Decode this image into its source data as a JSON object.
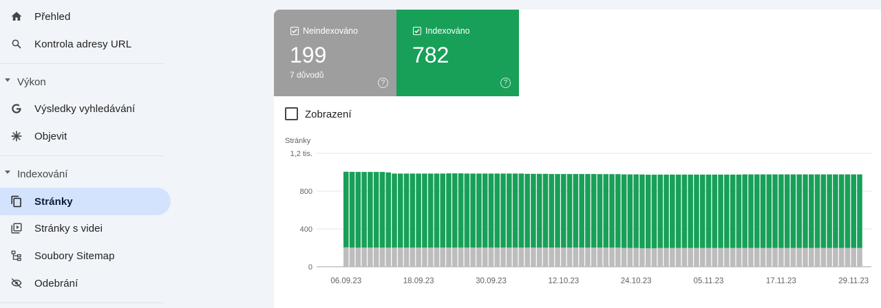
{
  "sidebar": {
    "overview": {
      "label": "Přehled",
      "icon": "home-icon"
    },
    "url_inspection": {
      "label": "Kontrola adresy URL",
      "icon": "search-icon"
    },
    "performance": {
      "section_label": "Výkon",
      "items": [
        {
          "label": "Výsledky vyhledávání",
          "icon": "google-g-icon"
        },
        {
          "label": "Objevit",
          "icon": "asterisk-icon"
        }
      ]
    },
    "indexing": {
      "section_label": "Indexování",
      "items": [
        {
          "label": "Stránky",
          "icon": "pages-icon",
          "active": true
        },
        {
          "label": "Stránky s videi",
          "icon": "video-pages-icon"
        },
        {
          "label": "Soubory Sitemap",
          "icon": "sitemap-icon"
        },
        {
          "label": "Odebrání",
          "icon": "eye-off-icon"
        }
      ]
    }
  },
  "cards": {
    "not_indexed": {
      "label": "Neindexováno",
      "value": "199",
      "sub": "7 důvodů",
      "color": "#9e9e9e",
      "checked": true
    },
    "indexed": {
      "label": "Indexováno",
      "value": "782",
      "color": "#18a058",
      "checked": true
    }
  },
  "overlay": {
    "label": "Zobrazení",
    "checked": false
  },
  "chart_data": {
    "type": "bar",
    "stacked": true,
    "ylabel": "Stránky",
    "ylim": [
      0,
      1200
    ],
    "y_ticks": [
      {
        "value": 0,
        "label": "0"
      },
      {
        "value": 400,
        "label": "400"
      },
      {
        "value": 800,
        "label": "800"
      },
      {
        "value": 1200,
        "label": "1,2 tis."
      }
    ],
    "x_tick_labels": [
      "06.09.23",
      "18.09.23",
      "30.09.23",
      "12.10.23",
      "24.10.23",
      "05.11.23",
      "17.11.23",
      "29.11.23"
    ],
    "x_tick_indices": [
      0,
      12,
      24,
      36,
      48,
      60,
      72,
      84
    ],
    "grid": true,
    "legend": "none",
    "series": [
      {
        "name": "Neindexováno",
        "color": "#bdbdbd",
        "values": [
          205,
          203,
          202,
          203,
          203,
          203,
          203,
          203,
          203,
          203,
          203,
          203,
          203,
          203,
          203,
          203,
          203,
          203,
          203,
          203,
          203,
          203,
          203,
          203,
          203,
          203,
          203,
          203,
          203,
          203,
          203,
          203,
          203,
          203,
          203,
          203,
          203,
          203,
          203,
          203,
          203,
          203,
          203,
          203,
          203,
          203,
          199,
          199,
          199,
          197,
          195,
          195,
          199,
          199,
          199,
          199,
          199,
          199,
          199,
          199,
          199,
          199,
          199,
          199,
          199,
          199,
          199,
          199,
          199,
          199,
          199,
          199,
          199,
          199,
          199,
          199,
          199,
          199,
          199,
          199,
          199,
          199,
          199,
          199,
          199,
          199
        ]
      },
      {
        "name": "Indexováno",
        "color": "#18a058",
        "values": [
          800,
          801,
          801,
          800,
          800,
          800,
          800,
          795,
          783,
          783,
          783,
          783,
          783,
          783,
          783,
          783,
          783,
          785,
          785,
          785,
          783,
          783,
          783,
          783,
          783,
          783,
          783,
          783,
          783,
          783,
          780,
          780,
          780,
          780,
          778,
          778,
          778,
          778,
          778,
          778,
          778,
          778,
          777,
          777,
          777,
          777,
          778,
          778,
          778,
          779,
          779,
          779,
          776,
          776,
          776,
          776,
          776,
          776,
          776,
          776,
          776,
          776,
          776,
          776,
          776,
          776,
          778,
          778,
          778,
          778,
          778,
          778,
          778,
          778,
          778,
          778,
          778,
          778,
          778,
          778,
          778,
          778,
          778,
          778,
          778,
          778
        ]
      }
    ]
  }
}
